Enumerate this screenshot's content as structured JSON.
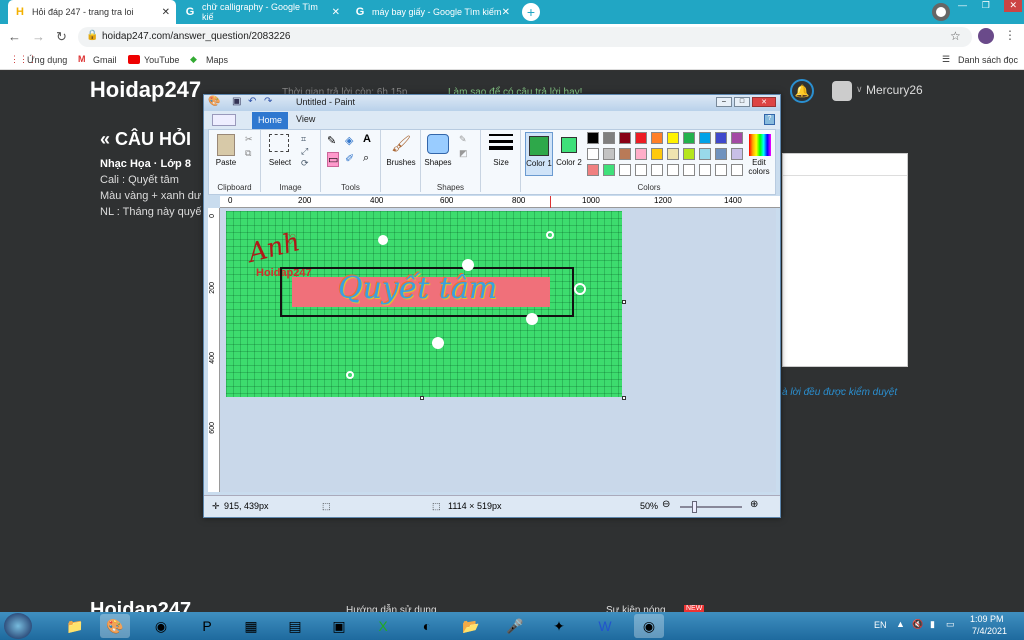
{
  "browser": {
    "tabs": [
      {
        "title": "Hỏi đáp 247 - trang tra loi",
        "active": true,
        "favicon": "H"
      },
      {
        "title": "chữ calligraphy - Google Tìm kiế",
        "active": false,
        "favicon": "G"
      },
      {
        "title": "máy bay giấy - Google Tìm kiếm",
        "active": false,
        "favicon": "G"
      }
    ],
    "url": "hoidap247.com/answer_question/2083226",
    "bookmarks": [
      "Ứng dụng",
      "Gmail",
      "YouTube",
      "Maps"
    ],
    "reading_list": "Danh sách đọc"
  },
  "site": {
    "logo": "Hoidap247",
    "header_partial_1": "Thời gian trả lời còn: 6h 15p",
    "header_partial_2": "Làm sao để có câu trả lời hay!",
    "username": "Mercury26",
    "question_heading": "« CÂU HỎI",
    "subject": "Nhạc Họa · Lớp 8",
    "lines": [
      "Cali : Quyết tâm",
      "Màu vàng + xanh dư",
      "NL : Tháng này quyế"
    ],
    "pending_note": "à lời đều được kiểm duyệt",
    "footer_logo": "Hoidap247",
    "footer_link_1": "Hướng dẫn sử dụng",
    "footer_link_2": "Sự kiện nóng",
    "new_badge": "NEW"
  },
  "paint": {
    "title": "Untitled - Paint",
    "tabs": [
      "Home",
      "View"
    ],
    "groups": {
      "clipboard": {
        "label": "Clipboard",
        "paste": "Paste"
      },
      "image": {
        "label": "Image",
        "select": "Select"
      },
      "tools": {
        "label": "Tools"
      },
      "brushes": {
        "label": "Brushes"
      },
      "shapes": {
        "label": "Shapes",
        "shapes_btn": "Shapes"
      },
      "size": {
        "label": "Size"
      },
      "colors": {
        "label": "Colors",
        "color1": "Color 1",
        "color2": "Color 2",
        "edit": "Edit colors"
      }
    },
    "color1": "#2ea84a",
    "color2": "#3fe07a",
    "palette": [
      "#000000",
      "#7f7f7f",
      "#880015",
      "#ed1c24",
      "#ff7f27",
      "#fff200",
      "#22b14c",
      "#00a2e8",
      "#3f48cc",
      "#a349a4",
      "#ffffff",
      "#c3c3c3",
      "#b97a57",
      "#ffaec9",
      "#ffc90e",
      "#efe4b0",
      "#b5e61d",
      "#99d9ea",
      "#7092be",
      "#c8bfe7",
      "#f08080",
      "#3fe07a",
      "#ffffff",
      "#ffffff",
      "#ffffff",
      "#ffffff",
      "#ffffff",
      "#ffffff",
      "#ffffff",
      "#ffffff"
    ],
    "ruler_marks": [
      "0",
      "200",
      "400",
      "600",
      "800",
      "1000",
      "1200",
      "1400"
    ],
    "ruler_v_marks": [
      "0",
      "200",
      "400",
      "600"
    ],
    "canvas": {
      "bg": "#3ddc6e",
      "signature": "Anh",
      "watermark": "Hoidap247",
      "calligraphy": "Quyết tâm",
      "banner_color": "#f0707a"
    },
    "status": {
      "cursor": "915, 439px",
      "size": "1114 × 519px",
      "zoom": "50%"
    }
  },
  "taskbar": {
    "lang": "EN",
    "time": "1:09 PM",
    "date": "7/4/2021"
  }
}
